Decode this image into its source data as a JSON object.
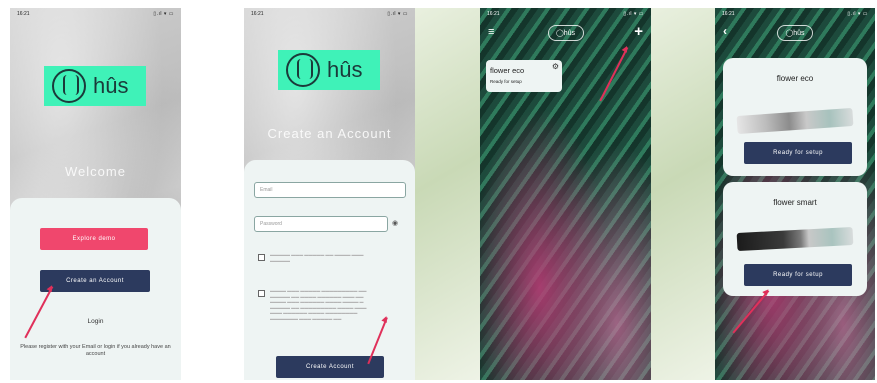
{
  "status": {
    "time": "16:21",
    "icons": "▯.ıl ▾ ▭"
  },
  "screen1": {
    "brand": "hûs",
    "welcome": "Welcome",
    "explore_demo": "Explore demo",
    "create_account": "Create an Account",
    "login": "Login",
    "help": "Please register with your Email or login if you already have an account"
  },
  "screen2": {
    "brand": "hûs",
    "title": "Create an Account",
    "email_placeholder": "Email",
    "password_placeholder": "Password",
    "create_button": "Create Account"
  },
  "screen3": {
    "device_name": "flower eco",
    "device_status": "Ready for setup"
  },
  "screen4": {
    "cards": [
      {
        "title": "flower eco",
        "button": "Ready for setup"
      },
      {
        "title": "flower smart",
        "button": "Ready for setup"
      }
    ]
  },
  "colors": {
    "accent": "#3ff2b8",
    "primary": "#2c3a5e",
    "demo": "#f0476d",
    "annotation": "#e0305a"
  }
}
